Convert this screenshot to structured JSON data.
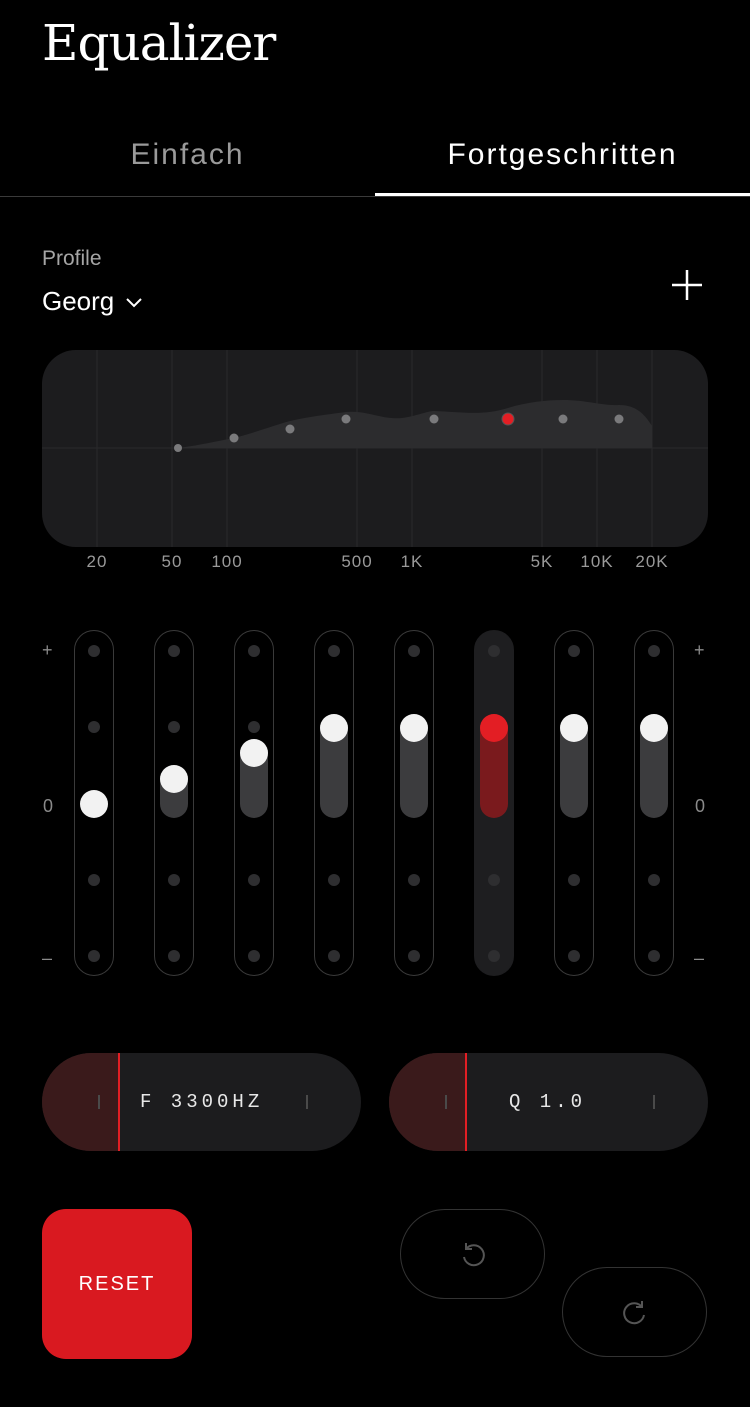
{
  "header": {
    "title": "Equalizer"
  },
  "tabs": [
    {
      "label": "Einfach",
      "active": false
    },
    {
      "label": "Fortgeschritten",
      "active": true
    }
  ],
  "profile": {
    "label": "Profile",
    "selected": "Georg"
  },
  "graph": {
    "frequency_labels": [
      "20",
      "50",
      "100",
      "500",
      "1K",
      "5K",
      "10K",
      "20K"
    ]
  },
  "scale": {
    "plus": "+",
    "zero": "0",
    "minus": "–"
  },
  "bands": [
    {
      "level": 0,
      "selected": false
    },
    {
      "level": 0.33,
      "selected": false
    },
    {
      "level": 0.67,
      "selected": false
    },
    {
      "level": 1,
      "selected": false
    },
    {
      "level": 1,
      "selected": false
    },
    {
      "level": 1,
      "selected": true
    },
    {
      "level": 1,
      "selected": false
    },
    {
      "level": 1,
      "selected": false
    }
  ],
  "frequency_control": {
    "label": "F 3300HZ"
  },
  "q_control": {
    "label": "Q 1.0"
  },
  "actions": {
    "reset_label": "RESET"
  },
  "colors": {
    "accent": "#e31e24",
    "background": "#000000",
    "panel": "#1c1c1e"
  }
}
